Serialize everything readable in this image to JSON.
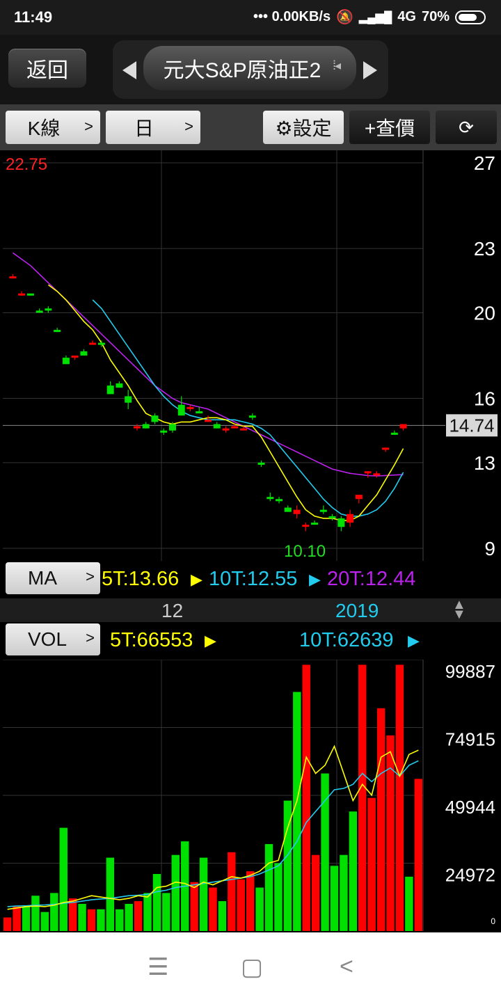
{
  "status": {
    "time": "11:49",
    "net": "••• 0.00KB/s",
    "signal": "4G",
    "battery": "70%"
  },
  "header": {
    "back": "返回",
    "title": "元大S&P原油正2"
  },
  "toolbar": {
    "kline": "K線",
    "period": "日",
    "settings": "⚙設定",
    "quote": "+查價"
  },
  "colors": {
    "up": "#ff0000",
    "down": "#00e000",
    "ma5": "#ffff00",
    "ma10": "#22ccee",
    "ma20": "#bb22ee"
  },
  "ma": {
    "label": "MA",
    "ma5": "5T:13.66",
    "ma10": "10T:12.55",
    "ma20": "20T:12.44"
  },
  "dates": {
    "d1": "12",
    "d2": "2019"
  },
  "vol": {
    "label": "VOL",
    "ma5": "5T:66553",
    "ma10": "10T:62639"
  },
  "chart_data": [
    {
      "type": "candlestick",
      "ylim": [
        9,
        27
      ],
      "y_ticks": [
        "27",
        "23",
        "20",
        "16",
        "13",
        "9"
      ],
      "max_label": "22.75",
      "min_label": "10.10",
      "last_price": "14.74",
      "candles": [
        [
          21.7,
          21.8,
          21.6,
          21.7
        ],
        [
          20.9,
          21.0,
          20.8,
          20.9
        ],
        [
          20.9,
          20.9,
          20.8,
          20.8
        ],
        [
          20.1,
          20.2,
          20.0,
          20.0
        ],
        [
          20.2,
          20.3,
          20.0,
          20.1
        ],
        [
          19.2,
          19.3,
          19.1,
          19.1
        ],
        [
          17.9,
          18.0,
          17.6,
          17.6
        ],
        [
          17.9,
          18.0,
          17.8,
          18.0
        ],
        [
          18.2,
          18.3,
          18.0,
          18.0
        ],
        [
          18.6,
          18.7,
          18.5,
          18.6
        ],
        [
          18.6,
          18.7,
          18.4,
          18.5
        ],
        [
          16.6,
          16.8,
          16.2,
          16.2
        ],
        [
          16.7,
          16.8,
          16.5,
          16.5
        ],
        [
          16.1,
          16.4,
          15.5,
          15.8
        ],
        [
          14.7,
          14.8,
          14.5,
          14.7
        ],
        [
          14.8,
          14.9,
          14.6,
          14.6
        ],
        [
          15.2,
          15.3,
          14.8,
          14.9
        ],
        [
          14.5,
          14.6,
          14.3,
          14.4
        ],
        [
          14.8,
          14.9,
          14.4,
          14.5
        ],
        [
          15.7,
          16.1,
          15.2,
          15.2
        ],
        [
          15.5,
          15.7,
          15.4,
          15.6
        ],
        [
          15.4,
          15.6,
          15.3,
          15.3
        ],
        [
          15.0,
          15.2,
          14.9,
          15.0
        ],
        [
          14.8,
          14.9,
          14.6,
          14.6
        ],
        [
          14.5,
          14.7,
          14.4,
          14.6
        ],
        [
          14.7,
          14.8,
          14.6,
          14.7
        ],
        [
          14.6,
          14.7,
          14.5,
          14.6
        ],
        [
          15.2,
          15.3,
          15.0,
          15.1
        ],
        [
          13.0,
          13.1,
          12.8,
          12.9
        ],
        [
          11.4,
          11.6,
          11.2,
          11.3
        ],
        [
          11.3,
          11.4,
          11.1,
          11.2
        ],
        [
          10.9,
          11.0,
          10.7,
          10.7
        ],
        [
          10.6,
          11.0,
          10.4,
          10.8
        ],
        [
          10.1,
          10.2,
          9.8,
          10.1
        ],
        [
          10.2,
          10.3,
          10.1,
          10.1
        ],
        [
          10.8,
          11.0,
          10.6,
          10.7
        ],
        [
          10.5,
          10.6,
          10.3,
          10.4
        ],
        [
          10.4,
          10.5,
          9.8,
          10.0
        ],
        [
          10.2,
          10.8,
          10.0,
          10.6
        ],
        [
          11.3,
          11.5,
          11.1,
          11.5
        ],
        [
          12.5,
          12.6,
          12.3,
          12.6
        ],
        [
          12.4,
          12.6,
          12.3,
          12.5
        ],
        [
          13.6,
          13.7,
          13.5,
          13.7
        ],
        [
          14.4,
          14.5,
          14.3,
          14.3
        ],
        [
          14.6,
          14.8,
          14.5,
          14.8
        ]
      ],
      "ma5": [
        null,
        null,
        null,
        null,
        21.3,
        21.0,
        20.6,
        20.1,
        19.6,
        19.2,
        18.6,
        17.8,
        17.2,
        16.6,
        15.9,
        15.3,
        15.1,
        14.9,
        14.8,
        14.9,
        14.9,
        15.0,
        15.1,
        15.1,
        15.0,
        14.8,
        14.7,
        14.7,
        14.2,
        13.5,
        12.8,
        12.1,
        11.4,
        10.8,
        10.5,
        10.4,
        10.4,
        10.3,
        10.3,
        10.5,
        11.0,
        11.5,
        12.2,
        12.9,
        13.66
      ],
      "ma10": [
        null,
        null,
        null,
        null,
        null,
        null,
        null,
        null,
        null,
        20.6,
        20.2,
        19.6,
        19.0,
        18.4,
        17.8,
        17.2,
        16.6,
        16.1,
        15.7,
        15.4,
        15.2,
        15.1,
        15.0,
        15.0,
        15.0,
        15.0,
        14.9,
        14.8,
        14.6,
        14.3,
        13.8,
        13.3,
        12.8,
        12.3,
        11.8,
        11.3,
        10.9,
        10.6,
        10.5,
        10.5,
        10.6,
        10.8,
        11.2,
        11.8,
        12.55
      ],
      "ma20": [
        22.8,
        22.5,
        22.2,
        21.8,
        21.4,
        21.0,
        20.6,
        20.2,
        19.8,
        19.4,
        19.0,
        18.6,
        18.2,
        17.8,
        17.4,
        17.0,
        16.6,
        16.3,
        16.0,
        15.8,
        15.7,
        15.6,
        15.5,
        15.3,
        15.1,
        14.9,
        14.7,
        14.5,
        14.3,
        14.1,
        13.9,
        13.7,
        13.5,
        13.3,
        13.1,
        12.9,
        12.7,
        12.6,
        12.5,
        12.45,
        12.4,
        12.38,
        12.4,
        12.42,
        12.44
      ]
    },
    {
      "type": "bar",
      "ylim": [
        0,
        99887
      ],
      "y_ticks": [
        "99887",
        "74915",
        "49944",
        "24972",
        "0"
      ],
      "volumes": [
        5000,
        9000,
        9000,
        13000,
        7000,
        14000,
        38000,
        12000,
        10000,
        8000,
        8000,
        27000,
        8000,
        10000,
        11000,
        14000,
        21000,
        14000,
        28000,
        33000,
        18000,
        27000,
        16000,
        11000,
        29000,
        19000,
        22000,
        16000,
        32000,
        25000,
        48000,
        88000,
        98000,
        28000,
        58000,
        24000,
        28000,
        44000,
        98000,
        49000,
        82000,
        72000,
        98000,
        20000,
        56000
      ],
      "ma5": [
        8000,
        8500,
        9000,
        9200,
        9000,
        9500,
        10500,
        11000,
        12000,
        13000,
        12500,
        12000,
        11500,
        12000,
        13000,
        12500,
        16000,
        16500,
        18000,
        17500,
        16000,
        18000,
        17000,
        18500,
        20000,
        19500,
        20500,
        22000,
        25000,
        26000,
        38000,
        48000,
        64000,
        58000,
        61000,
        68000,
        58000,
        48000,
        54000,
        50000,
        64000,
        66000,
        57000,
        65000,
        66553
      ],
      "ma10": [
        9000,
        9200,
        9300,
        9500,
        9600,
        9800,
        10200,
        10500,
        11000,
        11500,
        11800,
        12000,
        12500,
        13000,
        13200,
        13500,
        14500,
        15000,
        16000,
        16500,
        17000,
        17500,
        18000,
        18500,
        19000,
        19500,
        20000,
        21000,
        22500,
        24000,
        28000,
        33000,
        40000,
        44000,
        48000,
        52000,
        52500,
        54000,
        58000,
        55000,
        58000,
        60000,
        57000,
        61000,
        62639
      ]
    }
  ]
}
